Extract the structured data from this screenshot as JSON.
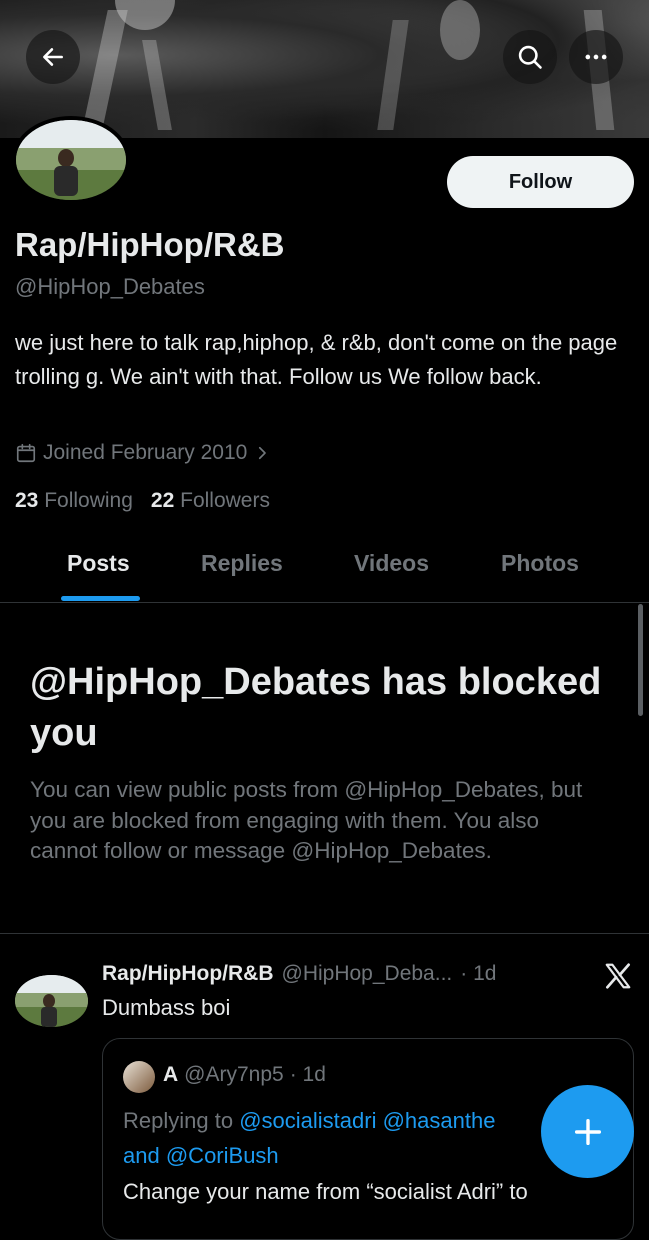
{
  "profile": {
    "name": "Rap/HipHop/R&B",
    "handle": "@HipHop_Debates",
    "bio": "we just here to talk rap,hiphop, & r&b, don't come on the page trolling g. We ain't with that. Follow us We follow back.",
    "joined": "Joined February 2010",
    "following_count": "23",
    "following_label": "Following",
    "followers_count": "22",
    "followers_label": "Followers",
    "follow_button": "Follow"
  },
  "tabs": [
    {
      "label": "Posts"
    },
    {
      "label": "Replies"
    },
    {
      "label": "Videos"
    },
    {
      "label": "Photos"
    }
  ],
  "blocked": {
    "title": "@HipHop_Debates has blocked you",
    "message": "You can view public posts from @HipHop_Debates, but you are blocked from engaging with them. You also cannot follow or message @HipHop_Debates."
  },
  "post": {
    "name": "Rap/HipHop/R&B",
    "handle": "@HipHop_Deba...",
    "time": "· 1d",
    "text": "Dumbass boi",
    "quote": {
      "name": "A",
      "handle": "@Ary7np5",
      "time": "· 1d",
      "replying_to": "Replying to",
      "mention1": "@socialistadri",
      "mention2": "@hasanthe",
      "and_text": "and",
      "mention3": "@CoriBush",
      "text_cut": "Change your name from “socialist Adri” to"
    }
  },
  "colors": {
    "accent": "#1d9bf0",
    "secondary_text": "#71767b",
    "primary_text": "#e7e9ea",
    "background": "#000000"
  },
  "icons": [
    "back-arrow-icon",
    "search-icon",
    "more-icon",
    "calendar-icon",
    "chevron-right-icon",
    "x-logo-icon",
    "compose-plus-icon"
  ]
}
